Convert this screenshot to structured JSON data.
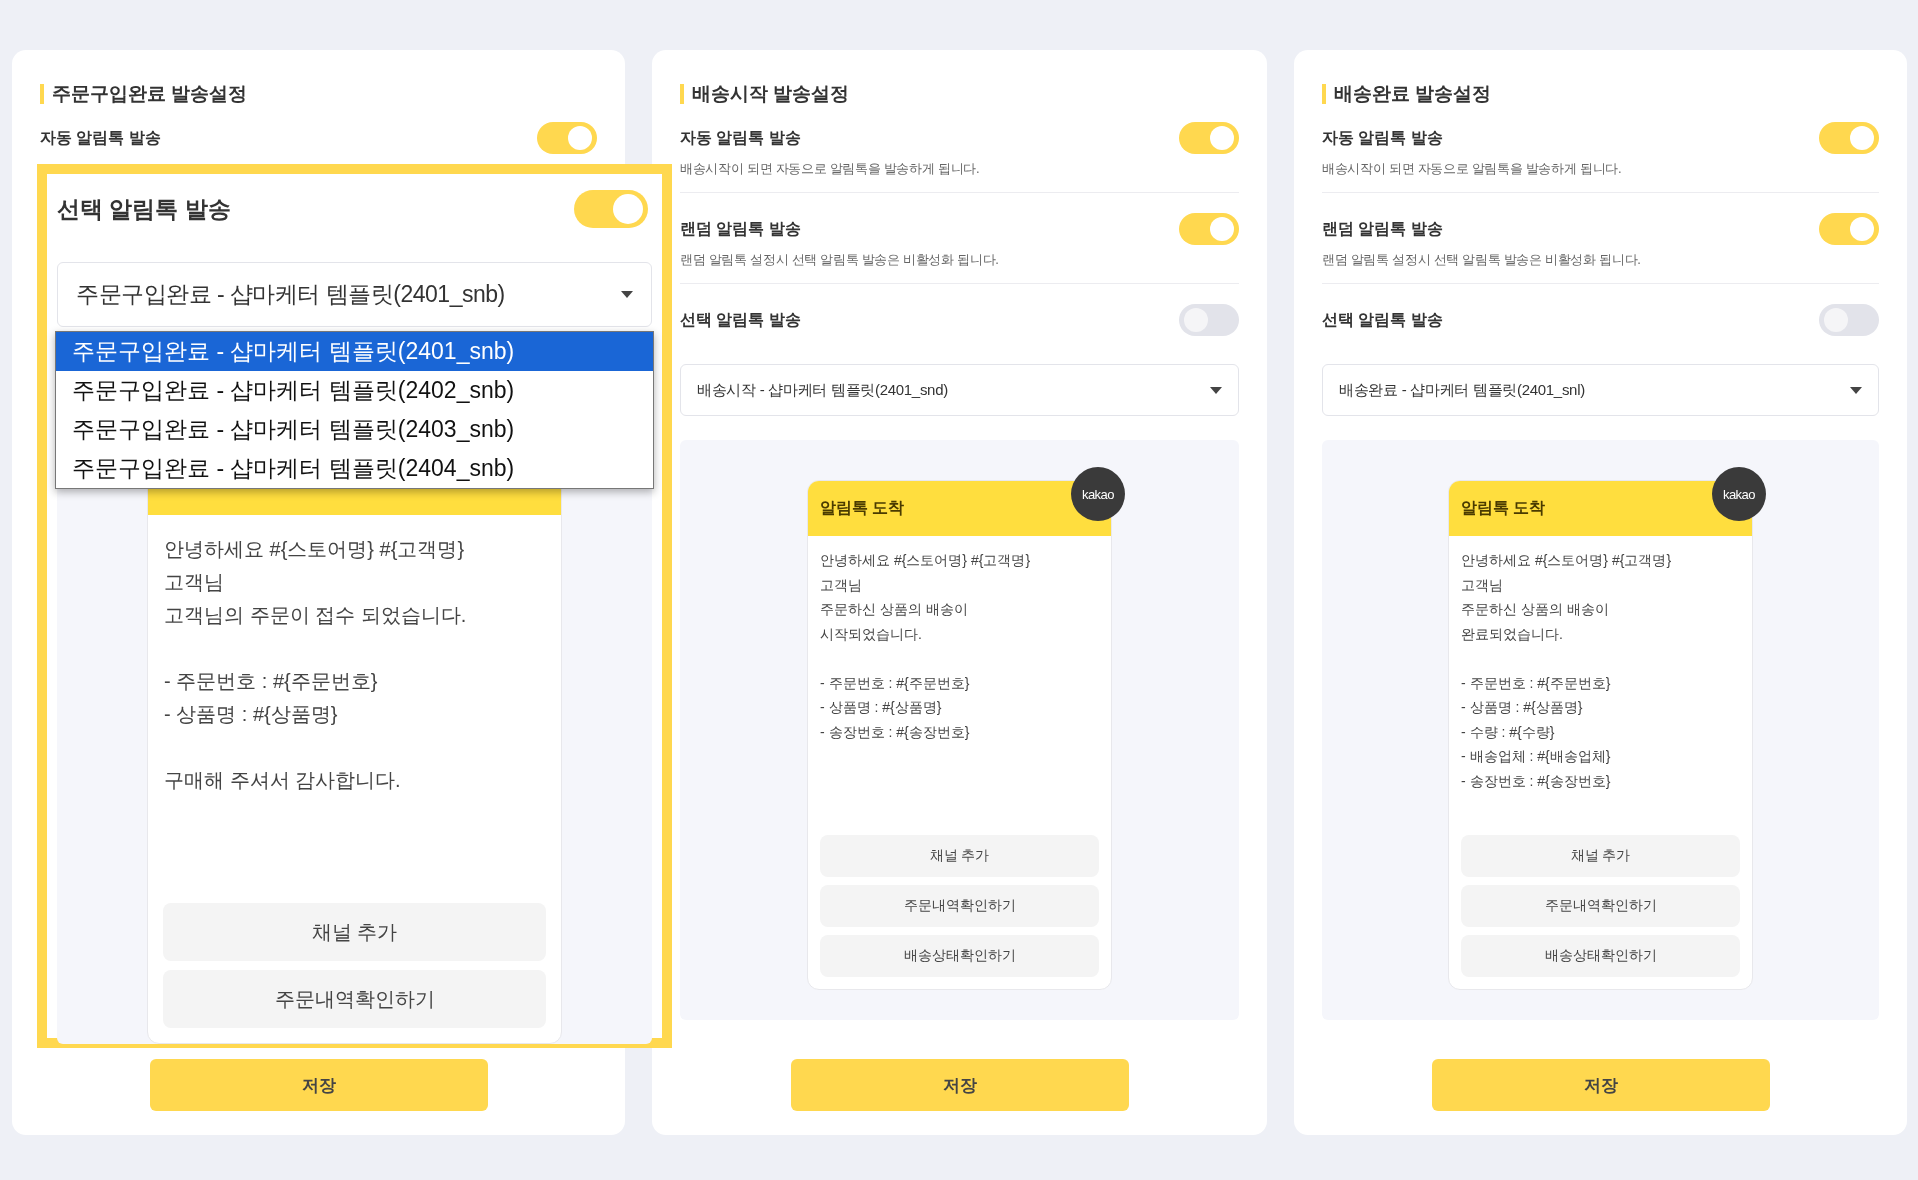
{
  "panels": [
    {
      "title": "주문구입완료 발송설정",
      "settings": [
        {
          "label": "자동 알림톡 발송",
          "on": true
        }
      ],
      "save_button": "저장"
    },
    {
      "title": "배송시작 발송설정",
      "settings": [
        {
          "label": "자동 알림톡 발송",
          "description": "배송시작이 되면 자동으로 알림톡을 발송하게 됩니다.",
          "on": true
        },
        {
          "label": "랜덤 알림톡 발송",
          "description": "랜덤 알림톡 설정시 선택 알림톡 발송은 비활성화 됩니다.",
          "on": true
        },
        {
          "label": "선택 알림톡 발송",
          "on": false
        }
      ],
      "template_select": {
        "value": "배송시작 - 샵마케터 템플릿(2401_snd)"
      },
      "preview": {
        "header": "알림톡 도착",
        "badge": "kakao",
        "message": "안녕하세요 #{스토어명} #{고객명}\n고객님\n주문하신 상품의 배송이\n시작되었습니다.\n\n- 주문번호 : #{주문번호}\n- 상품명 : #{상품명}\n- 송장번호 : #{송장번호}",
        "buttons": [
          "채널 추가",
          "주문내역확인하기",
          "배송상태확인하기"
        ]
      },
      "save_button": "저장"
    },
    {
      "title": "배송완료 발송설정",
      "settings": [
        {
          "label": "자동 알림톡 발송",
          "description": "배송시작이 되면 자동으로 알림톡을 발송하게 됩니다.",
          "on": true
        },
        {
          "label": "랜덤 알림톡 발송",
          "description": "랜덤 알림톡 설정시 선택 알림톡 발송은 비활성화 됩니다.",
          "on": true
        },
        {
          "label": "선택 알림톡 발송",
          "on": false
        }
      ],
      "template_select": {
        "value": "배송완료 - 샵마케터 템플릿(2401_snl)"
      },
      "preview": {
        "header": "알림톡 도착",
        "badge": "kakao",
        "message": "안녕하세요 #{스토어명} #{고객명}\n고객님\n주문하신 상품의 배송이\n완료되었습니다.\n\n- 주문번호 : #{주문번호}\n- 상품명 : #{상품명}\n- 수량 : #{수량}\n- 배송업체 : #{배송업체}\n- 송장번호 : #{송장번호}",
        "buttons": [
          "채널 추가",
          "주문내역확인하기",
          "배송상태확인하기"
        ]
      },
      "save_button": "저장"
    }
  ],
  "callout": {
    "setting": {
      "label": "선택 알림톡 발송",
      "on": true
    },
    "template_select": {
      "value": "주문구입완료 - 샵마케터 템플릿(2401_snb)",
      "options": [
        {
          "label": "주문구입완료 - 샵마케터 템플릿(2401_snb)",
          "selected": true
        },
        {
          "label": "주문구입완료 - 샵마케터 템플릿(2402_snb)",
          "selected": false
        },
        {
          "label": "주문구입완료 - 샵마케터 템플릿(2403_snb)",
          "selected": false
        },
        {
          "label": "주문구입완료 - 샵마케터 템플릿(2404_snb)",
          "selected": false
        }
      ]
    },
    "preview": {
      "message": "안녕하세요 #{스토어명} #{고객명}\n고객님\n고객님의 주문이 접수 되었습니다.\n\n- 주문번호 : #{주문번호}\n- 상품명 : #{상품명}\n\n구매해 주셔서 감사합니다.",
      "buttons": [
        "채널 추가",
        "주문내역확인하기"
      ]
    }
  }
}
